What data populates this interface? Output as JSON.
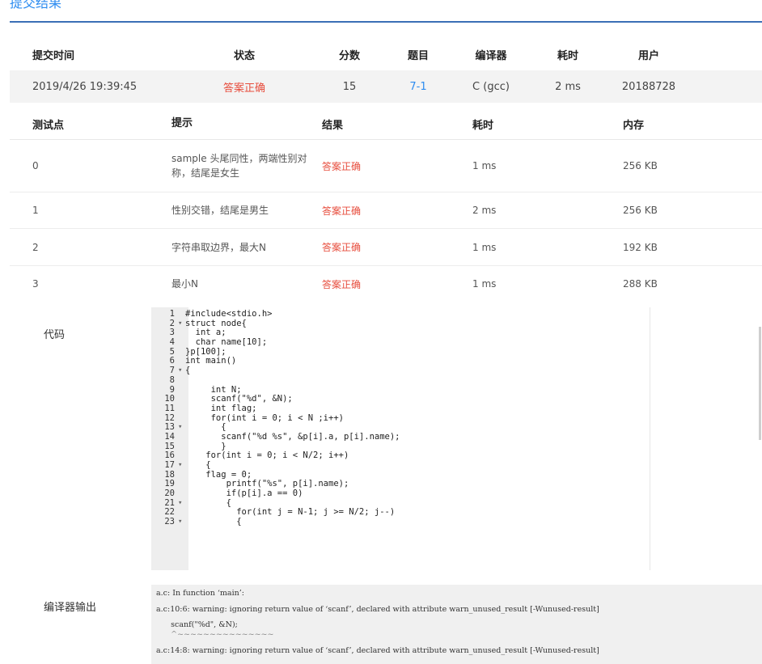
{
  "page": {
    "title": "提交结果"
  },
  "summary": {
    "headers": [
      "提交时间",
      "状态",
      "分数",
      "题目",
      "编译器",
      "耗时",
      "用户"
    ],
    "row": {
      "time": "2019/4/26 19:39:45",
      "status": "答案正确",
      "score": "15",
      "problem": "7-1",
      "compiler": "C (gcc)",
      "elapsed": "2 ms",
      "user": "20188728"
    }
  },
  "cases": {
    "headers": [
      "测试点",
      "提示",
      "结果",
      "耗时",
      "内存"
    ],
    "rows": [
      {
        "id": "0",
        "hint": "sample 头尾同性，两端性别对称，结尾是女生",
        "result": "答案正确",
        "time": "1 ms",
        "memory": "256 KB"
      },
      {
        "id": "1",
        "hint": "性别交错，结尾是男生",
        "result": "答案正确",
        "time": "2 ms",
        "memory": "256 KB"
      },
      {
        "id": "2",
        "hint": "字符串取边界，最大N",
        "result": "答案正确",
        "time": "1 ms",
        "memory": "192 KB"
      },
      {
        "id": "3",
        "hint": "最小N",
        "result": "答案正确",
        "time": "1 ms",
        "memory": "288 KB"
      }
    ]
  },
  "code": {
    "label": "代码",
    "lines": [
      {
        "n": "1",
        "fold": "",
        "text": "#include<stdio.h>"
      },
      {
        "n": "2",
        "fold": "▾",
        "text": "struct node{"
      },
      {
        "n": "3",
        "fold": "",
        "text": "  int a;"
      },
      {
        "n": "4",
        "fold": "",
        "text": "  char name[10];"
      },
      {
        "n": "5",
        "fold": "",
        "text": "}p[100];"
      },
      {
        "n": "6",
        "fold": "",
        "text": "int main()"
      },
      {
        "n": "7",
        "fold": "▾",
        "text": "{"
      },
      {
        "n": "8",
        "fold": "",
        "text": ""
      },
      {
        "n": "9",
        "fold": "",
        "text": "     int N;"
      },
      {
        "n": "10",
        "fold": "",
        "text": "     scanf(\"%d\", &N);"
      },
      {
        "n": "11",
        "fold": "",
        "text": "     int flag;"
      },
      {
        "n": "12",
        "fold": "",
        "text": "     for(int i = 0; i < N ;i++)"
      },
      {
        "n": "13",
        "fold": "▾",
        "text": "       {"
      },
      {
        "n": "14",
        "fold": "",
        "text": "       scanf(\"%d %s\", &p[i].a, p[i].name);"
      },
      {
        "n": "15",
        "fold": "",
        "text": "       }"
      },
      {
        "n": "16",
        "fold": "",
        "text": "    for(int i = 0; i < N/2; i++)"
      },
      {
        "n": "17",
        "fold": "▾",
        "text": "    {"
      },
      {
        "n": "18",
        "fold": "",
        "text": "    flag = 0;"
      },
      {
        "n": "19",
        "fold": "",
        "text": "        printf(\"%s\", p[i].name);"
      },
      {
        "n": "20",
        "fold": "",
        "text": "        if(p[i].a == 0)"
      },
      {
        "n": "21",
        "fold": "▾",
        "text": "        {"
      },
      {
        "n": "22",
        "fold": "",
        "text": "          for(int j = N-1; j >= N/2; j--)"
      },
      {
        "n": "23",
        "fold": "▾",
        "text": "          {"
      }
    ]
  },
  "compiler_output": {
    "label": "编译器输出",
    "lines": [
      "a.c: In function ‘main’:",
      "a.c:10:6: warning: ignoring return value of ‘scanf’, declared with attribute warn_unused_result [-Wunused-result]",
      "      scanf(\"%d\", &N);",
      "      ^~~~~~~~~~~~~~~~",
      "a.c:14:8: warning: ignoring return value of ‘scanf’, declared with attribute warn_unused_result [-Wunused-result]"
    ]
  },
  "colors": {
    "accent": "#2d8cf0",
    "status_ok": "#e74c3c",
    "header_rule": "#3b6fb6"
  }
}
